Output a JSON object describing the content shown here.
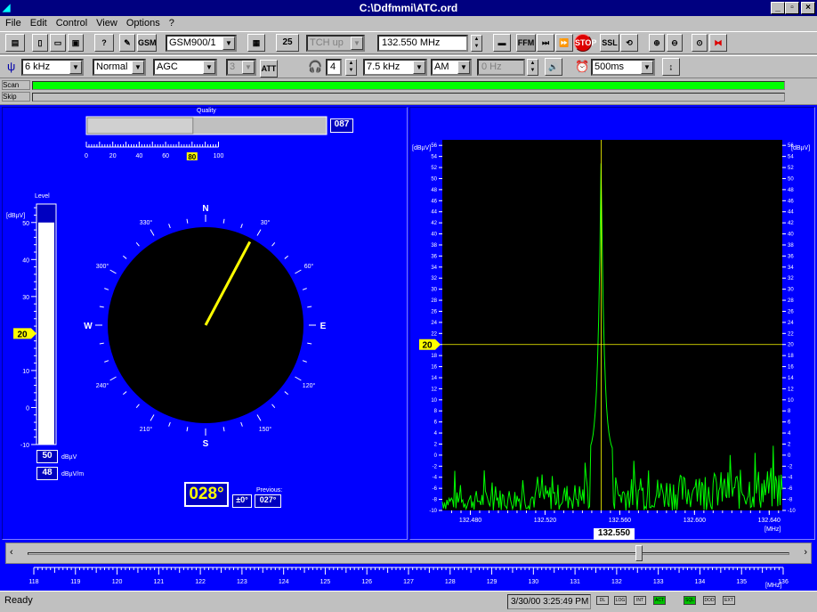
{
  "window": {
    "title": "C:\\Ddfmmi\\ATC.ord"
  },
  "menu": [
    "File",
    "Edit",
    "Control",
    "View",
    "Options",
    "?"
  ],
  "toolbar1": {
    "system_combo": "GSM900/1",
    "channel": "25",
    "tch_combo": "TCH up",
    "frequency": "132.550 MHz",
    "gsm_label": "GSM",
    "ffm_label": "FFM",
    "stop_label": "STOP",
    "ssl_label": "SSL"
  },
  "toolbar2": {
    "bandwidth_combo": "6 kHz",
    "mode_combo": "Normal",
    "agc_combo": "AGC",
    "gain_combo": "3",
    "volume": "4",
    "if_bw_combo": "7.5 kHz",
    "demod_combo": "AM",
    "offset": "0 Hz",
    "time_combo": "500ms"
  },
  "scan_rows": {
    "scan_label": "Scan",
    "skip_label": "Skip",
    "scan_color": "#00ff00"
  },
  "quality": {
    "label": "Quality",
    "value": 80,
    "readout": "087",
    "ticks": [
      "0",
      "20",
      "40",
      "60",
      "80",
      "100"
    ],
    "marker": "80"
  },
  "level": {
    "label": "Level",
    "unit": "[dBµV]",
    "value": 50,
    "scale_min": -10,
    "scale_max": 55,
    "ticks": [
      "50",
      "40",
      "30",
      "20",
      "10",
      "0",
      "-10"
    ],
    "squelch": "20",
    "readout_dbuv": "50",
    "readout_dbuvm": "48",
    "unit_dbuv": "dBµV",
    "unit_dbuvm": "dBµV/m"
  },
  "compass": {
    "bearing_deg": 28,
    "bearing_text": "028°",
    "tolerance": "±0°",
    "previous_label": "Previous:",
    "previous": "027°",
    "cardinals": [
      "N",
      "E",
      "S",
      "W"
    ],
    "degree_labels": [
      "30°",
      "60°",
      "120°",
      "150°",
      "210°",
      "240°",
      "300°",
      "330°"
    ]
  },
  "spectrum": {
    "unit_left": "[dBµV]",
    "unit_right": "[dBµV]",
    "y_ticks": [
      "56",
      "54",
      "52",
      "50",
      "48",
      "46",
      "44",
      "42",
      "40",
      "38",
      "36",
      "34",
      "32",
      "30",
      "28",
      "26",
      "24",
      "22",
      "20",
      "18",
      "16",
      "14",
      "12",
      "10",
      "8",
      "6",
      "4",
      "2",
      "0",
      "-2",
      "-4",
      "-6",
      "-8",
      "-10"
    ],
    "x_ticks": [
      "132.480",
      "132.520",
      "132.560",
      "132.600",
      "132.640"
    ],
    "x_unit": "[MHz]",
    "center": "132.550",
    "threshold": "20",
    "peak_color": "#00ff00"
  },
  "freq_scale": {
    "ticks": [
      "118",
      "119",
      "120",
      "121",
      "122",
      "123",
      "124",
      "125",
      "126",
      "127",
      "128",
      "129",
      "130",
      "131",
      "132",
      "133",
      "134",
      "135",
      "136"
    ],
    "unit": "[MHz]",
    "current": 132.55
  },
  "status": {
    "text": "Ready",
    "datetime": "3/30/00 3:25:49 PM",
    "indicators": [
      "DL",
      "LOG",
      "INT",
      "ACT",
      "SQL",
      "DOD",
      "EXT"
    ]
  }
}
